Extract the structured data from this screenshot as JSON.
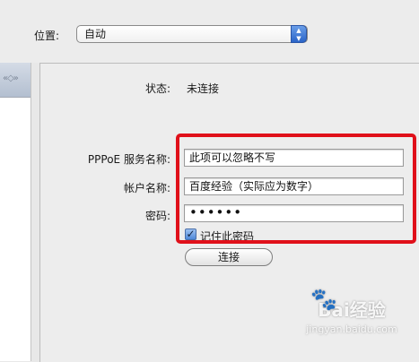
{
  "location": {
    "label": "位置:",
    "value": "自动"
  },
  "status": {
    "label": "状态:",
    "value": "未连接"
  },
  "form": {
    "service_label": "PPPoE 服务名称:",
    "service_value": "此项可以忽略不写",
    "account_label": "帐户名称:",
    "account_value": "百度经验（实际应为数字）",
    "password_label": "密码:",
    "password_value": "••••••",
    "remember_label": "记住此密码",
    "remember_checked": true
  },
  "buttons": {
    "connect": "连接"
  },
  "watermark": {
    "logo": "Bai经验",
    "url": "jingyan.baidu.com"
  },
  "colors": {
    "highlight": "#e0101a",
    "accent": "#2a64c8"
  }
}
